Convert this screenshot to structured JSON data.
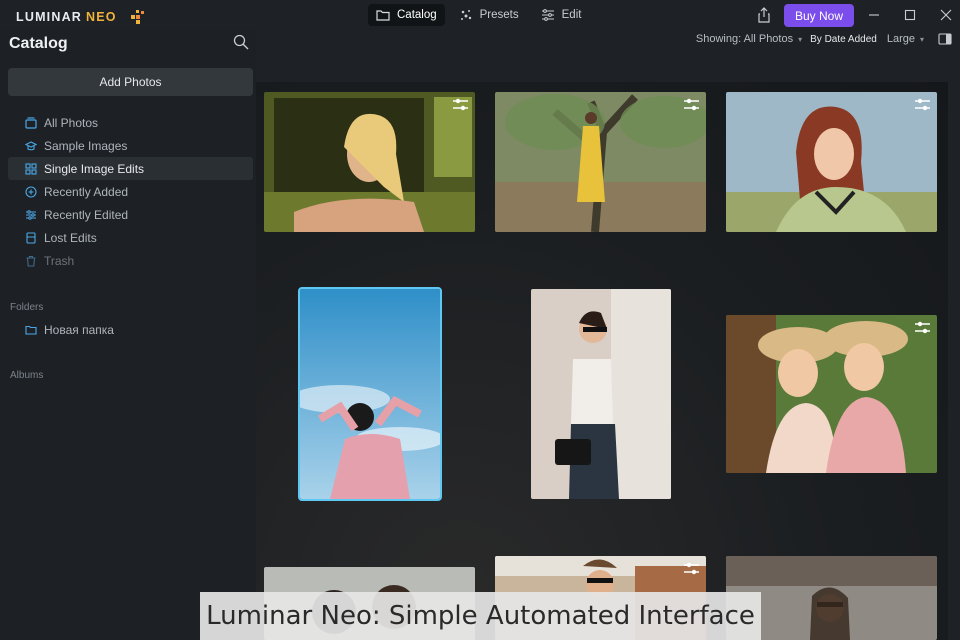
{
  "app": {
    "logo_primary": "LUMINAR",
    "logo_secondary": "NEO"
  },
  "tabs": [
    {
      "label": "Catalog",
      "icon": "folder-icon",
      "active": true
    },
    {
      "label": "Presets",
      "icon": "sparkle-icon",
      "active": false
    },
    {
      "label": "Edit",
      "icon": "sliders-icon",
      "active": false
    }
  ],
  "buy_now": "Buy Now",
  "accent": "#7b4dea",
  "sidebar": {
    "title": "Catalog",
    "add_photos": "Add Photos",
    "items": [
      {
        "label": "All Photos",
        "icon": "photos-icon"
      },
      {
        "label": "Sample Images",
        "icon": "graduation-cap-icon"
      },
      {
        "label": "Single Image Edits",
        "icon": "grid-icon",
        "active": true
      },
      {
        "label": "Recently Added",
        "icon": "plus-circle-icon"
      },
      {
        "label": "Recently Edited",
        "icon": "sliders-icon"
      },
      {
        "label": "Lost Edits",
        "icon": "document-icon"
      },
      {
        "label": "Trash",
        "icon": "trash-icon",
        "disabled": true
      }
    ],
    "folders_header": "Folders",
    "folders": [
      {
        "label": "Новая папка",
        "icon": "folder-icon"
      }
    ],
    "albums_header": "Albums"
  },
  "toolbar": {
    "showing": "Showing: All Photos",
    "sort": "By Date Added",
    "size": "Large"
  },
  "photos": [
    {
      "subject": "woman leaning out of green car window",
      "edited": true
    },
    {
      "subject": "woman in yellow dress under tree",
      "edited": true
    },
    {
      "subject": "woman with red hair smiling",
      "edited": true
    },
    {
      "subject": "woman in pink sweater against blue sky",
      "edited": false,
      "selected": true
    },
    {
      "subject": "woman with sunglasses and black bag",
      "edited": false
    },
    {
      "subject": "two women in straw hats",
      "edited": true
    },
    {
      "subject": "two women portrait",
      "edited": false
    },
    {
      "subject": "woman with sunglasses in street",
      "edited": true
    },
    {
      "subject": "woman with sunglasses sitting",
      "edited": false
    }
  ],
  "caption": "Luminar Neo: Simple Automated Interface"
}
